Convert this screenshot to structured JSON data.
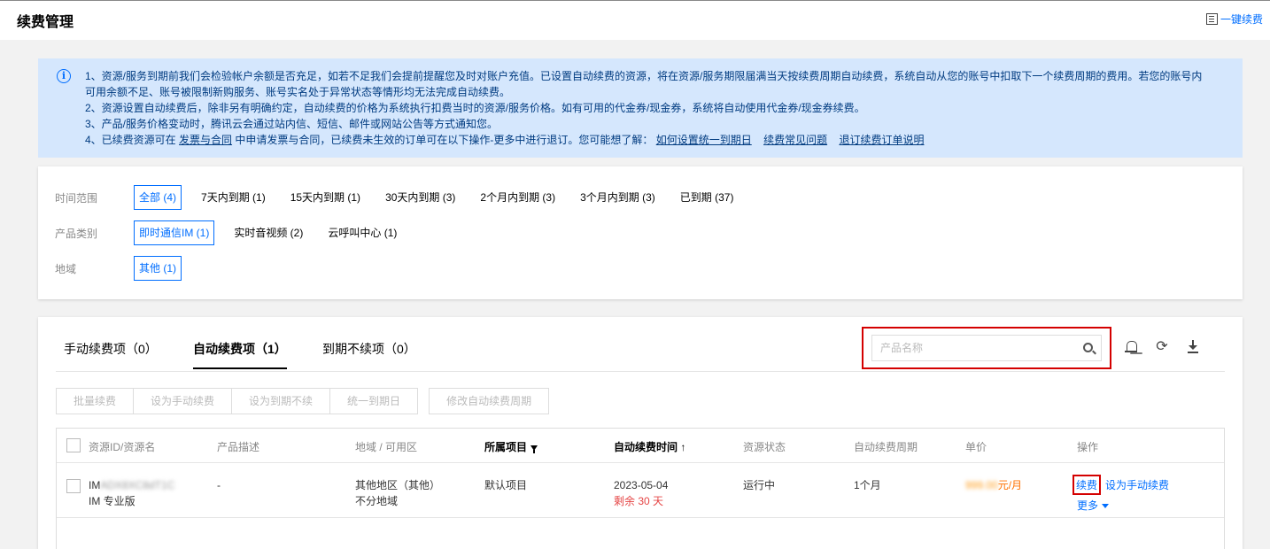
{
  "header": {
    "title": "续费管理",
    "renew_all": "一键续费"
  },
  "notice": {
    "line1a": "1、资源/服务到期前我们会检验帐户余额是否充足，如若不足我们会提前提醒您及时对账户充值。已设置自动续费的资源，将在资源/服务期限届满当天按续费周期自动续费，系统自动从您的账号中扣取下一个续费周期的费用。若您的账号内",
    "line1b": "可用余额不足、账号被限制新购服务、账号实名处于异常状态等情形均无法完成自动续费。",
    "line2": "2、资源设置自动续费后，除非另有明确约定，自动续费的价格为系统执行扣费当时的资源/服务价格。如有可用的代金券/现金券，系统将自动使用代金券/现金券续费。",
    "line3": "3、产品/服务价格变动时，腾讯云会通过站内信、短信、邮件或网站公告等方式通知您。",
    "line4_prefix": "4、已续费资源可在",
    "link_invoice": "发票与合同",
    "line4_middle": "中申请发票与合同，已续费未生效的订单可在以下操作-更多中进行退订。您可能想了解：",
    "link_unify": "如何设置统一到期日",
    "link_faq": "续费常见问题",
    "link_unsub": "退订续费订单说明"
  },
  "filters": {
    "time": {
      "label": "时间范围",
      "options": [
        "全部 (4)",
        "7天内到期 (1)",
        "15天内到期 (1)",
        "30天内到期 (3)",
        "2个月内到期 (3)",
        "3个月内到期 (3)",
        "已到期 (37)"
      ]
    },
    "product": {
      "label": "产品类别",
      "options": [
        "即时通信IM (1)",
        "实时音视频 (2)",
        "云呼叫中心 (1)"
      ]
    },
    "region": {
      "label": "地域",
      "options": [
        "其他 (1)"
      ]
    }
  },
  "tabs": [
    "手动续费项（0）",
    "自动续费项（1）",
    "到期不续项（0）"
  ],
  "search": {
    "placeholder": "产品名称"
  },
  "actions": [
    "批量续费",
    "设为手动续费",
    "设为到期不续",
    "统一到期日",
    "修改自动续费周期"
  ],
  "table": {
    "headers": [
      "资源ID/资源名",
      "产品描述",
      "地域 / 可用区",
      "所属项目",
      "自动续费时间",
      "资源状态",
      "自动续费周期",
      "单价",
      "操作"
    ],
    "row": {
      "id_prefix": "IM",
      "id_masked": "ADX8XC8dT1C",
      "name": "IM 专业版",
      "desc": "-",
      "region": "其他地区（其他）",
      "zone": "不分地域",
      "project": "默认项目",
      "renew_date": "2023-05-04",
      "remaining": "剩余 30 天",
      "status": "运行中",
      "period": "1个月",
      "price_masked": "999.00",
      "price_unit": "元/月",
      "op_renew": "续费",
      "op_manual": "设为手动续费",
      "op_more": "更多"
    }
  },
  "colors": {
    "primary": "#006eff",
    "highlight": "#d40000",
    "notice_bg": "#d5e7fd",
    "price": "#ff7200",
    "danger": "#e54545"
  }
}
